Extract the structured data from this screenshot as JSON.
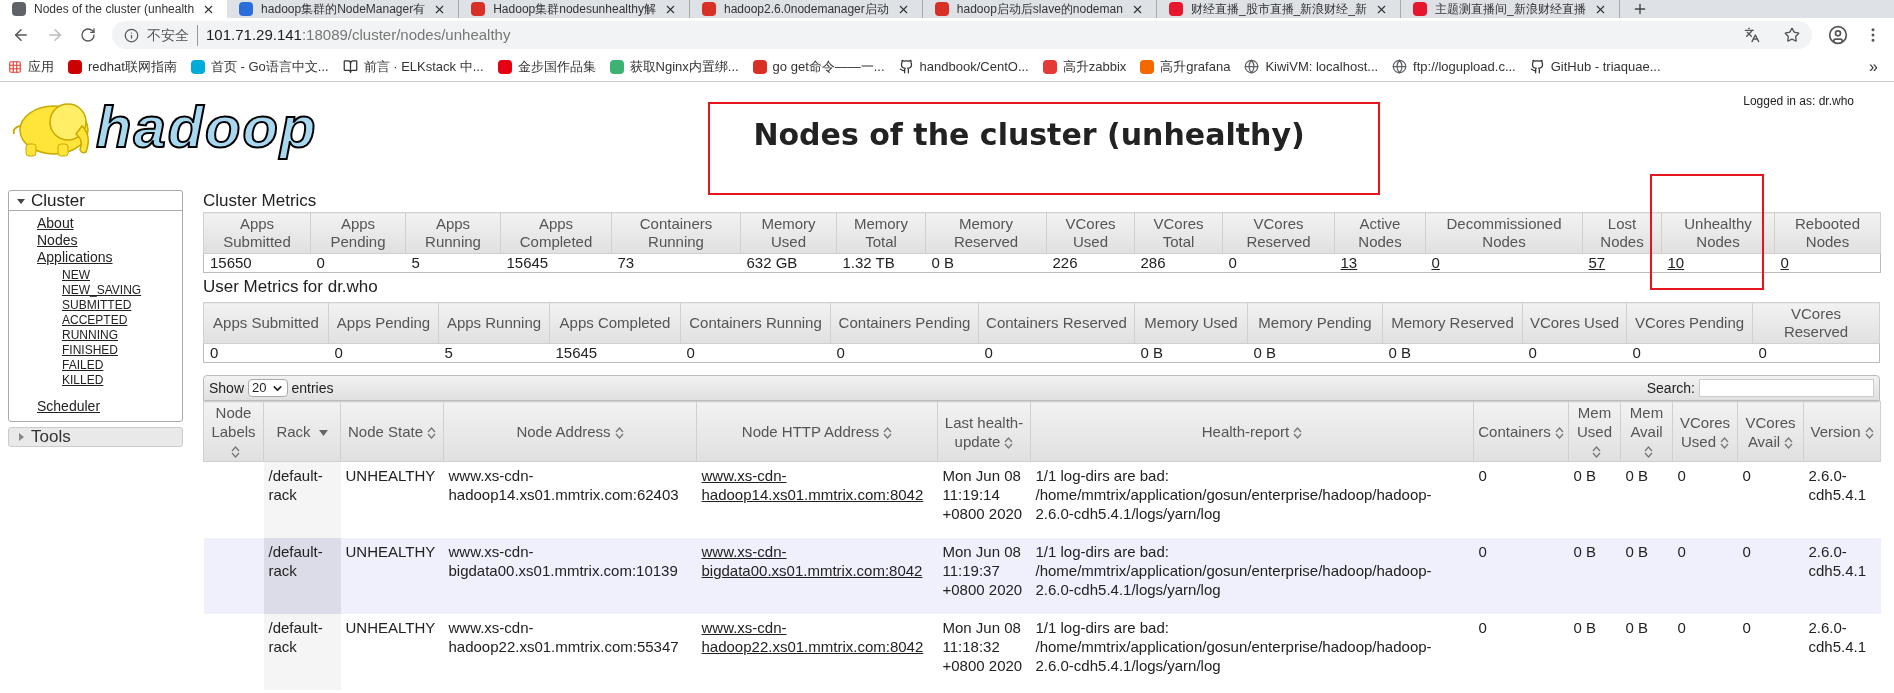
{
  "browser": {
    "tabs": [
      {
        "title": "Nodes of the cluster (unhealth",
        "selected": true
      },
      {
        "title": "hadoop集群的NodeManager有",
        "selected": false
      },
      {
        "title": "Hadoop集群nodesunhealthy解",
        "selected": false
      },
      {
        "title": "hadoop2.6.0nodemanager启动",
        "selected": false
      },
      {
        "title": "hadoop启动后slave的nodeman",
        "selected": false
      },
      {
        "title": "财经直播_股市直播_新浪财经_新",
        "selected": false
      },
      {
        "title": "主题测直播间_新浪财经直播",
        "selected": false
      }
    ],
    "address": {
      "security": "不安全",
      "host": "101.71.29.141",
      "path": ":18089/cluster/nodes/unhealthy"
    },
    "bookmarks": [
      {
        "label": "应用"
      },
      {
        "label": "redhat联网指南"
      },
      {
        "label": "首页 - Go语言中文..."
      },
      {
        "label": "前言 · ELKstack 中..."
      },
      {
        "label": "金步国作品集"
      },
      {
        "label": "获取Nginx内置绑..."
      },
      {
        "label": "go get命令——一..."
      },
      {
        "label": "handbook/CentO..."
      },
      {
        "label": "高升zabbix"
      },
      {
        "label": "高升grafana"
      },
      {
        "label": "KiwiVM: localhost..."
      },
      {
        "label": "ftp://logupload.c..."
      },
      {
        "label": "GitHub - triaquae..."
      }
    ],
    "bookmarks_more": "»"
  },
  "page": {
    "logo": "hadoop",
    "logged_in": "Logged in as: dr.who",
    "title": "Nodes of the cluster (unhealthy)"
  },
  "sidebar": {
    "cluster": {
      "label": "Cluster",
      "expanded": true,
      "items": [
        {
          "label": "About"
        },
        {
          "label": "Nodes"
        },
        {
          "label": "Applications",
          "children": [
            {
              "label": "NEW"
            },
            {
              "label": "NEW_SAVING"
            },
            {
              "label": "SUBMITTED"
            },
            {
              "label": "ACCEPTED"
            },
            {
              "label": "RUNNING"
            },
            {
              "label": "FINISHED"
            },
            {
              "label": "FAILED"
            },
            {
              "label": "KILLED"
            }
          ]
        },
        {
          "label": "Scheduler"
        }
      ]
    },
    "tools": {
      "label": "Tools",
      "expanded": false
    }
  },
  "cluster_metrics": {
    "title": "Cluster Metrics",
    "columns": [
      "Apps Submitted",
      "Apps Pending",
      "Apps Running",
      "Apps Completed",
      "Containers Running",
      "Memory Used",
      "Memory Total",
      "Memory Reserved",
      "VCores Used",
      "VCores Total",
      "VCores Reserved",
      "Active Nodes",
      "Decommissioned Nodes",
      "Lost Nodes",
      "Unhealthy Nodes",
      "Rebooted Nodes"
    ],
    "values": [
      {
        "text": "15650",
        "link": false
      },
      {
        "text": "0",
        "link": false
      },
      {
        "text": "5",
        "link": false
      },
      {
        "text": "15645",
        "link": false
      },
      {
        "text": "73",
        "link": false
      },
      {
        "text": "632 GB",
        "link": false
      },
      {
        "text": "1.32 TB",
        "link": false
      },
      {
        "text": "0 B",
        "link": false
      },
      {
        "text": "226",
        "link": false
      },
      {
        "text": "286",
        "link": false
      },
      {
        "text": "0",
        "link": false
      },
      {
        "text": "13",
        "link": true
      },
      {
        "text": "0",
        "link": true
      },
      {
        "text": "57",
        "link": true
      },
      {
        "text": "10",
        "link": true
      },
      {
        "text": "0",
        "link": true
      }
    ]
  },
  "user_metrics": {
    "title": "User Metrics for dr.who",
    "columns": [
      "Apps Submitted",
      "Apps Pending",
      "Apps Running",
      "Apps Completed",
      "Containers Running",
      "Containers Pending",
      "Containers Reserved",
      "Memory Used",
      "Memory Pending",
      "Memory Reserved",
      "VCores Used",
      "VCores Pending",
      "VCores Reserved"
    ],
    "values": [
      "0",
      "0",
      "5",
      "15645",
      "0",
      "0",
      "0",
      "0 B",
      "0 B",
      "0 B",
      "0",
      "0",
      "0"
    ]
  },
  "nodes_table": {
    "show": "Show",
    "page_size": "20",
    "entries": "entries",
    "search_label": "Search:",
    "columns": [
      {
        "label": "Node Labels",
        "sorted": false
      },
      {
        "label": "Rack",
        "sorted": true
      },
      {
        "label": "Node State",
        "sorted": false
      },
      {
        "label": "Node Address",
        "sorted": false
      },
      {
        "label": "Node HTTP Address",
        "sorted": false
      },
      {
        "label": "Last health-update",
        "sorted": false
      },
      {
        "label": "Health-report",
        "sorted": false
      },
      {
        "label": "Containers",
        "sorted": false
      },
      {
        "label": "Mem Used",
        "sorted": false
      },
      {
        "label": "Mem Avail",
        "sorted": false
      },
      {
        "label": "VCores Used",
        "sorted": false
      },
      {
        "label": "VCores Avail",
        "sorted": false
      },
      {
        "label": "Version",
        "sorted": false
      }
    ],
    "rows": [
      {
        "highlighted": false,
        "cells": [
          "",
          "/default-rack",
          "UNHEALTHY",
          "www.xs-cdn-hadoop14.xs01.mmtrix.com:62403",
          "www.xs-cdn-hadoop14.xs01.mmtrix.com:8042",
          "Mon Jun 08 11:19:14 +0800 2020",
          "1/1 log-dirs are bad: /home/mmtrix/application/gosun/enterprise/hadoop/hadoop-2.6.0-cdh5.4.1/logs/yarn/log",
          "0",
          "0 B",
          "0 B",
          "0",
          "0",
          "2.6.0-cdh5.4.1"
        ]
      },
      {
        "highlighted": true,
        "cells": [
          "",
          "/default-rack",
          "UNHEALTHY",
          "www.xs-cdn-bigdata00.xs01.mmtrix.com:10139",
          "www.xs-cdn-bigdata00.xs01.mmtrix.com:8042",
          "Mon Jun 08 11:19:37 +0800 2020",
          "1/1 log-dirs are bad: /home/mmtrix/application/gosun/enterprise/hadoop/hadoop-2.6.0-cdh5.4.1/logs/yarn/log",
          "0",
          "0 B",
          "0 B",
          "0",
          "0",
          "2.6.0-cdh5.4.1"
        ]
      },
      {
        "highlighted": false,
        "cells": [
          "",
          "/default-rack",
          "UNHEALTHY",
          "www.xs-cdn-hadoop22.xs01.mmtrix.com:55347",
          "www.xs-cdn-hadoop22.xs01.mmtrix.com:8042",
          "Mon Jun 08 11:18:32 +0800 2020",
          "1/1 log-dirs are bad: /home/mmtrix/application/gosun/enterprise/hadoop/hadoop-2.6.0-cdh5.4.1/logs/yarn/log",
          "0",
          "0 B",
          "0 B",
          "0",
          "0",
          "2.6.0-cdh5.4.1"
        ]
      }
    ]
  }
}
